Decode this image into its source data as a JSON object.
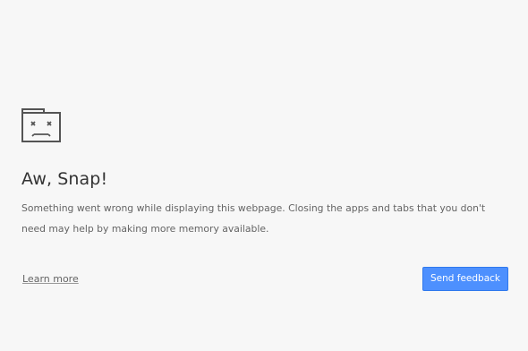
{
  "error_page": {
    "icon": "sad-tab-icon",
    "heading": "Aw, Snap!",
    "message": "Something went wrong while displaying this webpage. Closing the apps and tabs that you don't need may help by making more memory available.",
    "learn_more_label": "Learn more",
    "feedback_button_label": "Send feedback"
  },
  "colors": {
    "background": "#f7f7f7",
    "heading": "#333333",
    "body_text": "#646464",
    "icon": "#545454",
    "button": "#4d90fe",
    "button_text": "#ffffff"
  }
}
